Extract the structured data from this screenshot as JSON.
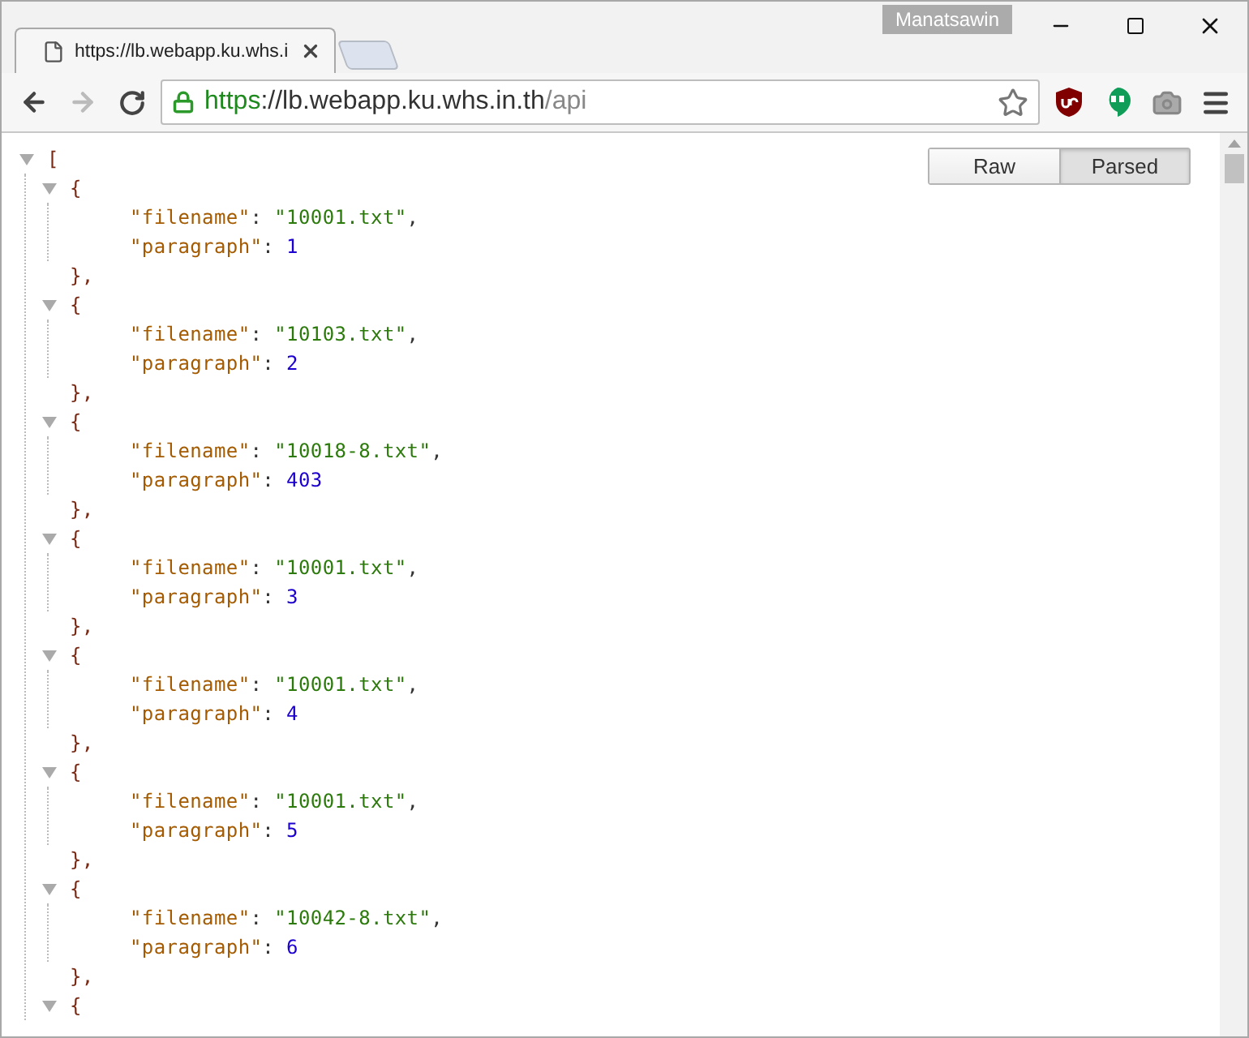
{
  "window": {
    "user": "Manatsawin"
  },
  "tabs": [
    {
      "title": "https://lb.webapp.ku.whs.i",
      "selected": true
    }
  ],
  "address": {
    "scheme": "https",
    "rest": "://lb.webapp.ku.whs.in.th",
    "path": "/api"
  },
  "view_toggle": [
    {
      "label": "Raw",
      "selected": false
    },
    {
      "label": "Parsed",
      "selected": true
    }
  ],
  "json_tree": {
    "open": "[",
    "expanded": true,
    "children": [
      {
        "open": "{",
        "expanded": true,
        "close": "},",
        "fields": [
          {
            "key": "\"filename\"",
            "sep": ":",
            "value": "\"10001.txt\"",
            "kind": "string",
            "end": ","
          },
          {
            "key": "\"paragraph\"",
            "sep": ":",
            "value": "1",
            "kind": "number"
          }
        ]
      },
      {
        "open": "{",
        "expanded": true,
        "close": "},",
        "fields": [
          {
            "key": "\"filename\"",
            "sep": ":",
            "value": "\"10103.txt\"",
            "kind": "string",
            "end": ","
          },
          {
            "key": "\"paragraph\"",
            "sep": ":",
            "value": "2",
            "kind": "number"
          }
        ]
      },
      {
        "open": "{",
        "expanded": true,
        "close": "},",
        "fields": [
          {
            "key": "\"filename\"",
            "sep": ":",
            "value": "\"10018-8.txt\"",
            "kind": "string",
            "end": ","
          },
          {
            "key": "\"paragraph\"",
            "sep": ":",
            "value": "403",
            "kind": "number"
          }
        ]
      },
      {
        "open": "{",
        "expanded": true,
        "close": "},",
        "fields": [
          {
            "key": "\"filename\"",
            "sep": ":",
            "value": "\"10001.txt\"",
            "kind": "string",
            "end": ","
          },
          {
            "key": "\"paragraph\"",
            "sep": ":",
            "value": "3",
            "kind": "number"
          }
        ]
      },
      {
        "open": "{",
        "expanded": true,
        "close": "},",
        "fields": [
          {
            "key": "\"filename\"",
            "sep": ":",
            "value": "\"10001.txt\"",
            "kind": "string",
            "end": ","
          },
          {
            "key": "\"paragraph\"",
            "sep": ":",
            "value": "4",
            "kind": "number"
          }
        ]
      },
      {
        "open": "{",
        "expanded": true,
        "close": "},",
        "fields": [
          {
            "key": "\"filename\"",
            "sep": ":",
            "value": "\"10001.txt\"",
            "kind": "string",
            "end": ","
          },
          {
            "key": "\"paragraph\"",
            "sep": ":",
            "value": "5",
            "kind": "number"
          }
        ]
      },
      {
        "open": "{",
        "expanded": true,
        "close": "},",
        "fields": [
          {
            "key": "\"filename\"",
            "sep": ":",
            "value": "\"10042-8.txt\"",
            "kind": "string",
            "end": ","
          },
          {
            "key": "\"paragraph\"",
            "sep": ":",
            "value": "6",
            "kind": "number"
          }
        ]
      },
      {
        "open": "{",
        "expanded": true
      }
    ]
  }
}
